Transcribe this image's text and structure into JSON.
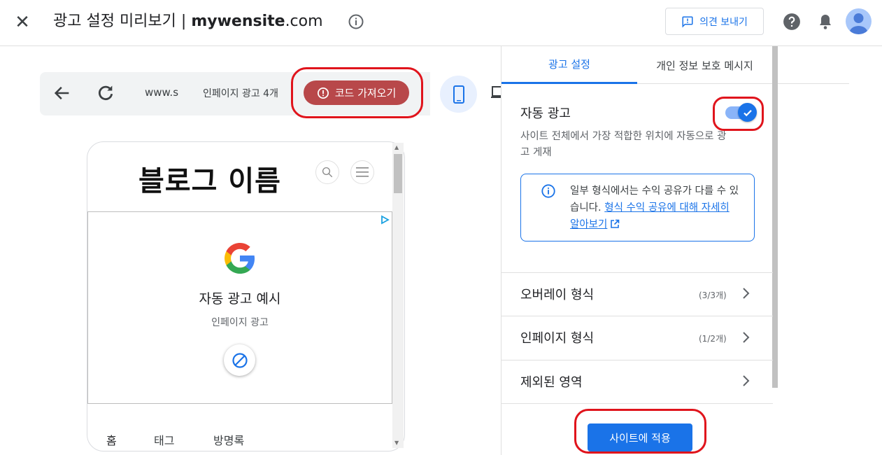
{
  "header": {
    "close_icon": "close-icon",
    "title_prefix": "광고 설정 미리보기 | ",
    "title_site": "mywensite",
    "title_tld": ".com",
    "feedback_label": "의견 보내기"
  },
  "browser": {
    "url": "www.s",
    "inpage_label": "인페이지 광고 4개",
    "get_code_label": "코드 가져오기"
  },
  "preview": {
    "blog_title": "블로그 이름",
    "ad_title": "자동 광고 예시",
    "ad_subtitle": "인페이지 광고",
    "nav": [
      "홈",
      "태그",
      "방명록"
    ]
  },
  "panel": {
    "tabs": [
      "광고 설정",
      "개인 정보 보호 메시지"
    ],
    "auto_ads_label": "자동 광고",
    "auto_ads_enabled": true,
    "auto_ads_desc": "사이트 전체에서 가장 적합한 위치에 자동으로 광고 게재",
    "info_text": "일부 형식에서는 수익 공유가 다를 수 있습니다. ",
    "info_link": "형식 수익 공유에 대해 자세히 알아보기",
    "rows": [
      {
        "label": "오버레이 형식",
        "count": "(3/3개)"
      },
      {
        "label": "인페이지 형식",
        "count": "(1/2개)"
      },
      {
        "label": "제외된 영역",
        "count": ""
      }
    ],
    "apply_label": "사이트에 적용"
  },
  "colors": {
    "accent": "#1a73e8",
    "get_code_bg": "#b8484a",
    "annotation_red": "#e0141c"
  }
}
